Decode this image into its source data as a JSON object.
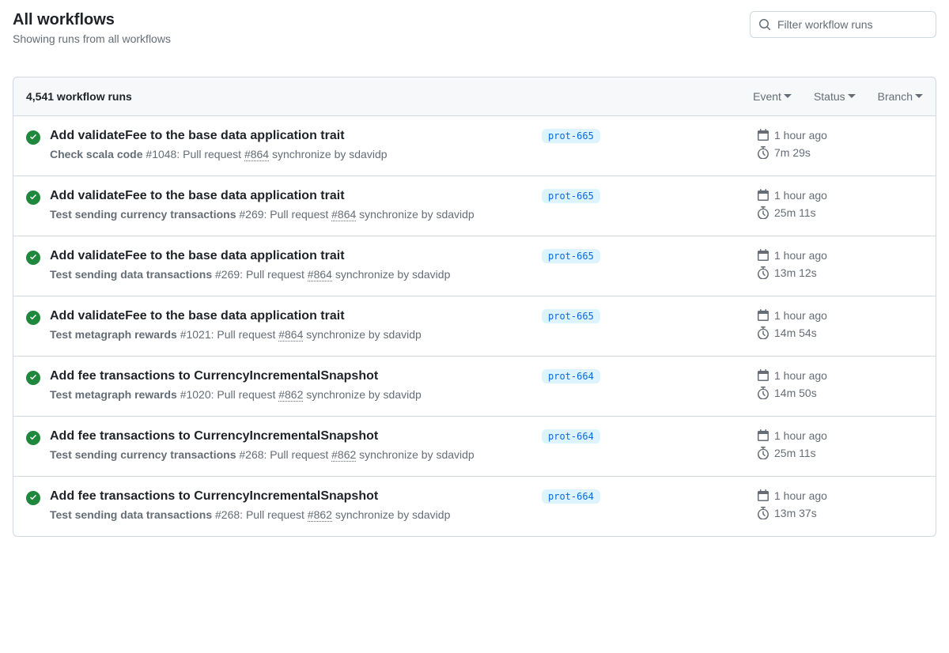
{
  "header": {
    "title": "All workflows",
    "subtitle": "Showing runs from all workflows"
  },
  "search": {
    "placeholder": "Filter workflow runs"
  },
  "toolbar": {
    "run_count": "4,541 workflow runs",
    "filters": {
      "event": "Event",
      "status": "Status",
      "branch": "Branch"
    }
  },
  "runs": [
    {
      "title": "Add validateFee to the base data application trait",
      "workflow": "Check scala code",
      "run_num": "#1048",
      "action_prefix": ": Pull request ",
      "pr": "#864",
      "action_suffix": " synchronize by sdavidp",
      "branch": "prot-665",
      "time_ago": "1 hour ago",
      "duration": "7m 29s"
    },
    {
      "title": "Add validateFee to the base data application trait",
      "workflow": "Test sending currency transactions",
      "run_num": "#269",
      "action_prefix": ": Pull request ",
      "pr": "#864",
      "action_suffix": " synchronize by sdavidp",
      "branch": "prot-665",
      "time_ago": "1 hour ago",
      "duration": "25m 11s"
    },
    {
      "title": "Add validateFee to the base data application trait",
      "workflow": "Test sending data transactions",
      "run_num": "#269",
      "action_prefix": ": Pull request ",
      "pr": "#864",
      "action_suffix": " synchronize by sdavidp",
      "branch": "prot-665",
      "time_ago": "1 hour ago",
      "duration": "13m 12s"
    },
    {
      "title": "Add validateFee to the base data application trait",
      "workflow": "Test metagraph rewards",
      "run_num": "#1021",
      "action_prefix": ": Pull request ",
      "pr": "#864",
      "action_suffix": " synchronize by sdavidp",
      "branch": "prot-665",
      "time_ago": "1 hour ago",
      "duration": "14m 54s"
    },
    {
      "title": "Add fee transactions to CurrencyIncrementalSnapshot",
      "workflow": "Test metagraph rewards",
      "run_num": "#1020",
      "action_prefix": ": Pull request ",
      "pr": "#862",
      "action_suffix": " synchronize by sdavidp",
      "branch": "prot-664",
      "time_ago": "1 hour ago",
      "duration": "14m 50s"
    },
    {
      "title": "Add fee transactions to CurrencyIncrementalSnapshot",
      "workflow": "Test sending currency transactions",
      "run_num": "#268",
      "action_prefix": ": Pull request ",
      "pr": "#862",
      "action_suffix": " synchronize by sdavidp",
      "branch": "prot-664",
      "time_ago": "1 hour ago",
      "duration": "25m 11s"
    },
    {
      "title": "Add fee transactions to CurrencyIncrementalSnapshot",
      "workflow": "Test sending data transactions",
      "run_num": "#268",
      "action_prefix": ": Pull request ",
      "pr": "#862",
      "action_suffix": " synchronize by sdavidp",
      "branch": "prot-664",
      "time_ago": "1 hour ago",
      "duration": "13m 37s"
    }
  ]
}
